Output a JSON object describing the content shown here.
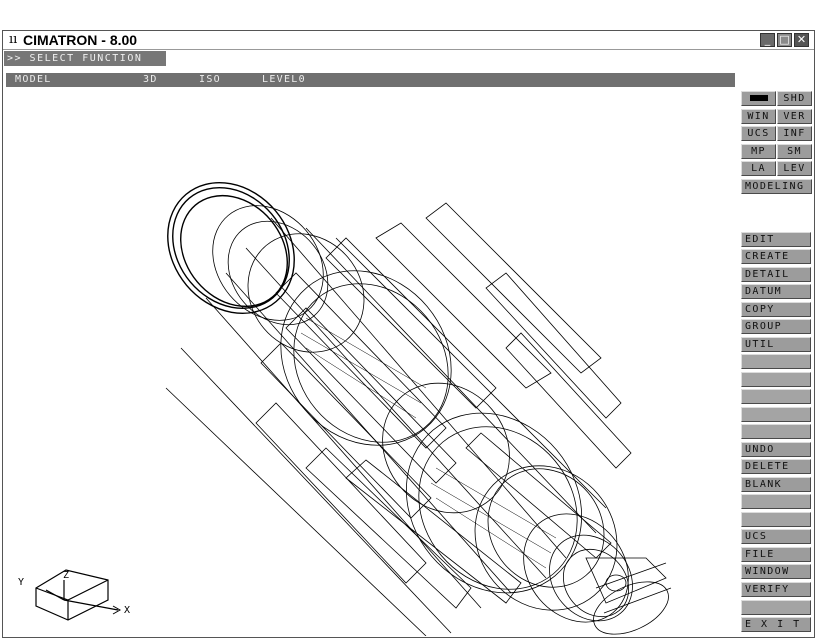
{
  "window": {
    "app_icon": "ıı",
    "title": "CIMATRON -  8.00",
    "controls": {
      "minimize": "_",
      "maximize": "□",
      "close": "✕"
    }
  },
  "command_prompt": ">> SELECT FUNCTION",
  "status": {
    "mode": "MODEL",
    "dimension": "3D",
    "view": "ISO",
    "level": "LEVEL0"
  },
  "right_panel": {
    "top_buttons": [
      [
        "",
        "SHD"
      ],
      [
        "WIN",
        "VER"
      ],
      [
        "UCS",
        "INF"
      ],
      [
        "MP",
        "SM"
      ],
      [
        "LA",
        "LEV"
      ]
    ],
    "modeling_label": "MODELING",
    "menu_main": [
      "EDIT",
      "CREATE",
      "DETAIL",
      "DATUM",
      "COPY",
      "GROUP",
      "UTIL"
    ],
    "menu_actions": [
      "UNDO",
      "DELETE",
      "BLANK"
    ],
    "menu_bottom": [
      "UCS",
      "FILE",
      "WINDOW",
      "VERIFY"
    ],
    "exit_label": "E X I T"
  },
  "axis_triad": {
    "x_label": "X",
    "y_label": "Y",
    "z_label": "Z"
  },
  "colors": {
    "button_face": "#9c9c9c",
    "status_bar": "#707070",
    "prompt_bar": "#777777",
    "wireframe": "#000000"
  }
}
